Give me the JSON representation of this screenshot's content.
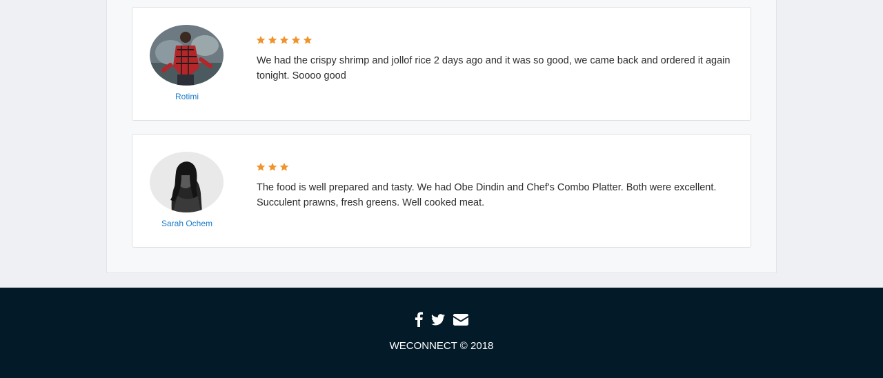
{
  "reviews": [
    {
      "reviewer": "Rotimi",
      "avatar": "reviewer-photo",
      "rating": 5,
      "text": "We had the crispy shrimp and jollof rice 2 days ago and it was so good, we came back and ordered it again tonight. Soooo good"
    },
    {
      "reviewer": "Sarah Ochem",
      "avatar": "reviewer-photo",
      "rating": 3,
      "text": "The food is well prepared and tasty. We had Obe Dindin and Chef's Combo Platter. Both were excellent. Succulent prawns, fresh greens. Well cooked meat."
    }
  ],
  "footer": {
    "social_icons": [
      "facebook-icon",
      "twitter-icon",
      "envelope-icon"
    ],
    "copyright": "WECONNECT © 2018"
  },
  "colors": {
    "page_bg": "#eef0f4",
    "footer_bg": "#031a29",
    "star": "#f0932b",
    "link": "#1a7bc9"
  }
}
